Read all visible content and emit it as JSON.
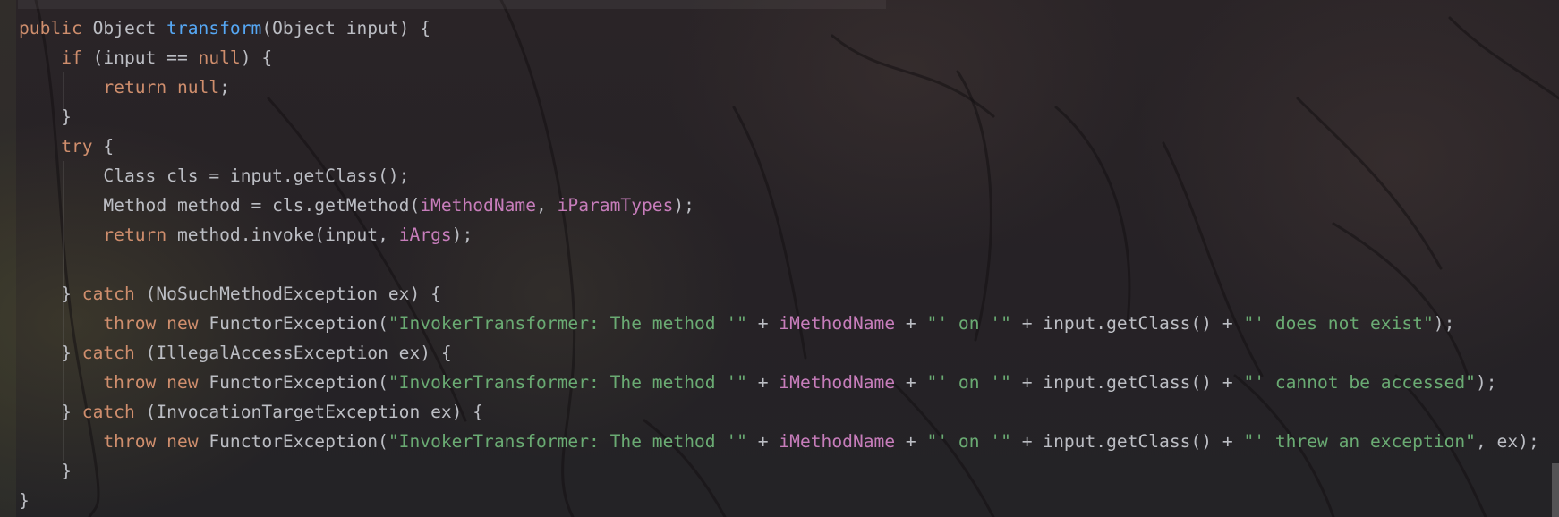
{
  "editor": {
    "lines": [
      [
        {
          "t": "public",
          "c": "kw"
        },
        {
          "t": " Object ",
          "c": "pl"
        },
        {
          "t": "transform",
          "c": "fn"
        },
        {
          "t": "(Object input) {",
          "c": "pl"
        }
      ],
      [
        {
          "t": "    ",
          "c": "pl"
        },
        {
          "t": "if",
          "c": "kw"
        },
        {
          "t": " (input == ",
          "c": "pl"
        },
        {
          "t": "null",
          "c": "kw"
        },
        {
          "t": ") {",
          "c": "pl"
        }
      ],
      [
        {
          "t": "        ",
          "c": "pl"
        },
        {
          "t": "return",
          "c": "kw"
        },
        {
          "t": " ",
          "c": "pl"
        },
        {
          "t": "null",
          "c": "kw"
        },
        {
          "t": ";",
          "c": "pl"
        }
      ],
      [
        {
          "t": "    }",
          "c": "pl"
        }
      ],
      [
        {
          "t": "    ",
          "c": "pl"
        },
        {
          "t": "try",
          "c": "kw"
        },
        {
          "t": " {",
          "c": "pl"
        }
      ],
      [
        {
          "t": "        Class cls = input.getClass();",
          "c": "pl"
        }
      ],
      [
        {
          "t": "        Method method = cls.getMethod(",
          "c": "pl"
        },
        {
          "t": "iMethodName",
          "c": "fld"
        },
        {
          "t": ", ",
          "c": "pl"
        },
        {
          "t": "iParamTypes",
          "c": "fld"
        },
        {
          "t": ");",
          "c": "pl"
        }
      ],
      [
        {
          "t": "        ",
          "c": "pl"
        },
        {
          "t": "return",
          "c": "kw"
        },
        {
          "t": " method.invoke(input, ",
          "c": "pl"
        },
        {
          "t": "iArgs",
          "c": "fld"
        },
        {
          "t": ");",
          "c": "pl"
        }
      ],
      [
        {
          "t": "",
          "c": "pl"
        }
      ],
      [
        {
          "t": "    } ",
          "c": "pl"
        },
        {
          "t": "catch",
          "c": "kw"
        },
        {
          "t": " (NoSuchMethodException ex) {",
          "c": "pl"
        }
      ],
      [
        {
          "t": "        ",
          "c": "pl"
        },
        {
          "t": "throw",
          "c": "kw"
        },
        {
          "t": " ",
          "c": "pl"
        },
        {
          "t": "new",
          "c": "kw"
        },
        {
          "t": " FunctorException(",
          "c": "pl"
        },
        {
          "t": "\"InvokerTransformer: The method '\"",
          "c": "str"
        },
        {
          "t": " + ",
          "c": "pl"
        },
        {
          "t": "iMethodName",
          "c": "fld"
        },
        {
          "t": " + ",
          "c": "pl"
        },
        {
          "t": "\"' on '\"",
          "c": "str"
        },
        {
          "t": " + input.getClass() + ",
          "c": "pl"
        },
        {
          "t": "\"' does not exist\"",
          "c": "str"
        },
        {
          "t": ");",
          "c": "pl"
        }
      ],
      [
        {
          "t": "    } ",
          "c": "pl"
        },
        {
          "t": "catch",
          "c": "kw"
        },
        {
          "t": " (IllegalAccessException ex) {",
          "c": "pl"
        }
      ],
      [
        {
          "t": "        ",
          "c": "pl"
        },
        {
          "t": "throw",
          "c": "kw"
        },
        {
          "t": " ",
          "c": "pl"
        },
        {
          "t": "new",
          "c": "kw"
        },
        {
          "t": " FunctorException(",
          "c": "pl"
        },
        {
          "t": "\"InvokerTransformer: The method '\"",
          "c": "str"
        },
        {
          "t": " + ",
          "c": "pl"
        },
        {
          "t": "iMethodName",
          "c": "fld"
        },
        {
          "t": " + ",
          "c": "pl"
        },
        {
          "t": "\"' on '\"",
          "c": "str"
        },
        {
          "t": " + input.getClass() + ",
          "c": "pl"
        },
        {
          "t": "\"' cannot be accessed\"",
          "c": "str"
        },
        {
          "t": ");",
          "c": "pl"
        }
      ],
      [
        {
          "t": "    } ",
          "c": "pl"
        },
        {
          "t": "catch",
          "c": "kw"
        },
        {
          "t": " (InvocationTargetException ex) {",
          "c": "pl"
        }
      ],
      [
        {
          "t": "        ",
          "c": "pl"
        },
        {
          "t": "throw",
          "c": "kw"
        },
        {
          "t": " ",
          "c": "pl"
        },
        {
          "t": "new",
          "c": "kw"
        },
        {
          "t": " FunctorException(",
          "c": "pl"
        },
        {
          "t": "\"InvokerTransformer: The method '\"",
          "c": "str"
        },
        {
          "t": " + ",
          "c": "pl"
        },
        {
          "t": "iMethodName",
          "c": "fld"
        },
        {
          "t": " + ",
          "c": "pl"
        },
        {
          "t": "\"' on '\"",
          "c": "str"
        },
        {
          "t": " + input.getClass() + ",
          "c": "pl"
        },
        {
          "t": "\"' threw an exception\"",
          "c": "str"
        },
        {
          "t": ", ex);",
          "c": "pl"
        }
      ],
      [
        {
          "t": "    }",
          "c": "pl"
        }
      ],
      [
        {
          "t": "}",
          "c": "pl"
        }
      ]
    ]
  },
  "theme": {
    "keyword": "#cf8e6d",
    "function": "#56a8f5",
    "field": "#c77dbb",
    "string": "#6aab73",
    "plain": "#bcbec4",
    "background": "#262226"
  }
}
